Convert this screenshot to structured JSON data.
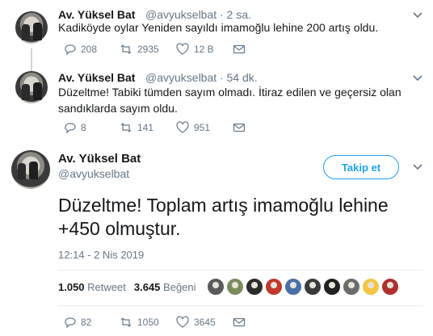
{
  "colors": {
    "accent": "#1da1f2",
    "text": "#14171a",
    "muted": "#657786"
  },
  "tweets": [
    {
      "name": "Av. Yüksel Bat",
      "handle": "@avyukselbat",
      "time": "· 2 sa.",
      "text": "Kadiköyde oylar Yeniden sayıldı imamoğlu lehine 200 artış oldu.",
      "replies": "208",
      "retweets": "2935",
      "likes": "12 B"
    },
    {
      "name": "Av. Yüksel Bat",
      "handle": "@avyukselbat",
      "time": "· 54 dk.",
      "text": "Düzeltme! Tabiki tümden sayım olmadı. İtiraz edilen ve geçersiz olan sandıklarda sayım oldu.",
      "replies": "8",
      "retweets": "141",
      "likes": "951"
    }
  ],
  "main": {
    "name": "Av. Yüksel Bat",
    "handle": "@avyukselbat",
    "follow_label": "Takip et",
    "text": "Düzeltme! Toplam artış imamoğlu lehine +450 olmuştur.",
    "timestamp": "12:14 - 2 Nis 2019",
    "retweet_count": "1.050",
    "retweet_label": "Retweet",
    "like_count": "3.645",
    "like_label": "Beğeni",
    "replies": "82",
    "retweets": "1050",
    "likes": "3645",
    "liker_colors": [
      "#5a5a5a",
      "#7a8c5c",
      "#2d2d2d",
      "#c0392b",
      "#4a6fa5",
      "#3b3b3b",
      "#222222",
      "#6b6b6b",
      "#f5c542",
      "#b03030"
    ]
  }
}
